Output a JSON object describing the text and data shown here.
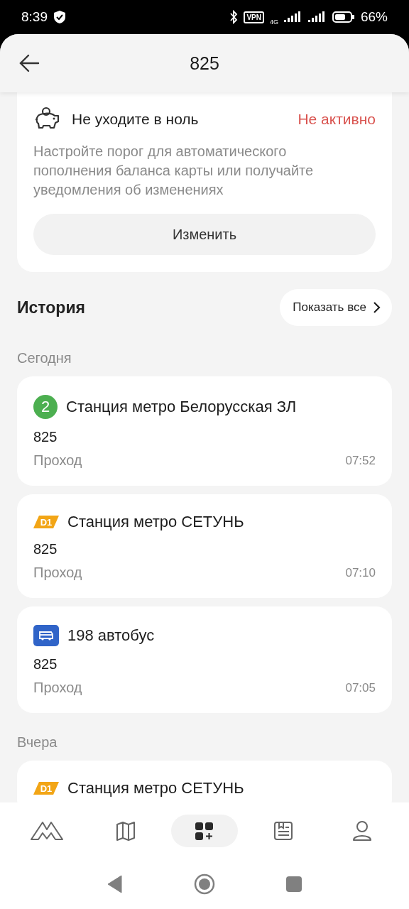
{
  "status_bar": {
    "time": "8:39",
    "vpn": "VPN",
    "network": "4G",
    "battery": "66%"
  },
  "header": {
    "title": "825"
  },
  "autopay_card": {
    "title": "Не уходите в ноль",
    "status": "Не активно",
    "description": "Настройте порог для автоматического пополнения баланса карты или получайте уведомления об изменениях",
    "button": "Изменить"
  },
  "history": {
    "title": "История",
    "show_all": "Показать все",
    "groups": [
      {
        "date": "Сегодня",
        "trips": [
          {
            "kind": "metro_line",
            "badge": "2",
            "color": "#4caf50",
            "station": "Станция метро Белорусская ЗЛ",
            "card": "825",
            "type": "Проход",
            "time": "07:52"
          },
          {
            "kind": "mcd",
            "badge": "D1",
            "color": "#f2a516",
            "station": "Станция метро СЕТУНЬ",
            "card": "825",
            "type": "Проход",
            "time": "07:10"
          },
          {
            "kind": "bus",
            "color": "#3064c8",
            "station": "198 автобус",
            "card": "825",
            "type": "Проход",
            "time": "07:05"
          }
        ]
      },
      {
        "date": "Вчера",
        "trips": [
          {
            "kind": "mcd",
            "badge": "D1",
            "color": "#f2a516",
            "station": "Станция метро СЕТУНЬ"
          }
        ]
      }
    ]
  },
  "bottom_nav": [
    {
      "kind": "metro",
      "selected": false
    },
    {
      "kind": "map",
      "selected": false
    },
    {
      "kind": "services",
      "selected": true
    },
    {
      "kind": "news",
      "selected": false
    },
    {
      "kind": "profile",
      "selected": false
    }
  ]
}
